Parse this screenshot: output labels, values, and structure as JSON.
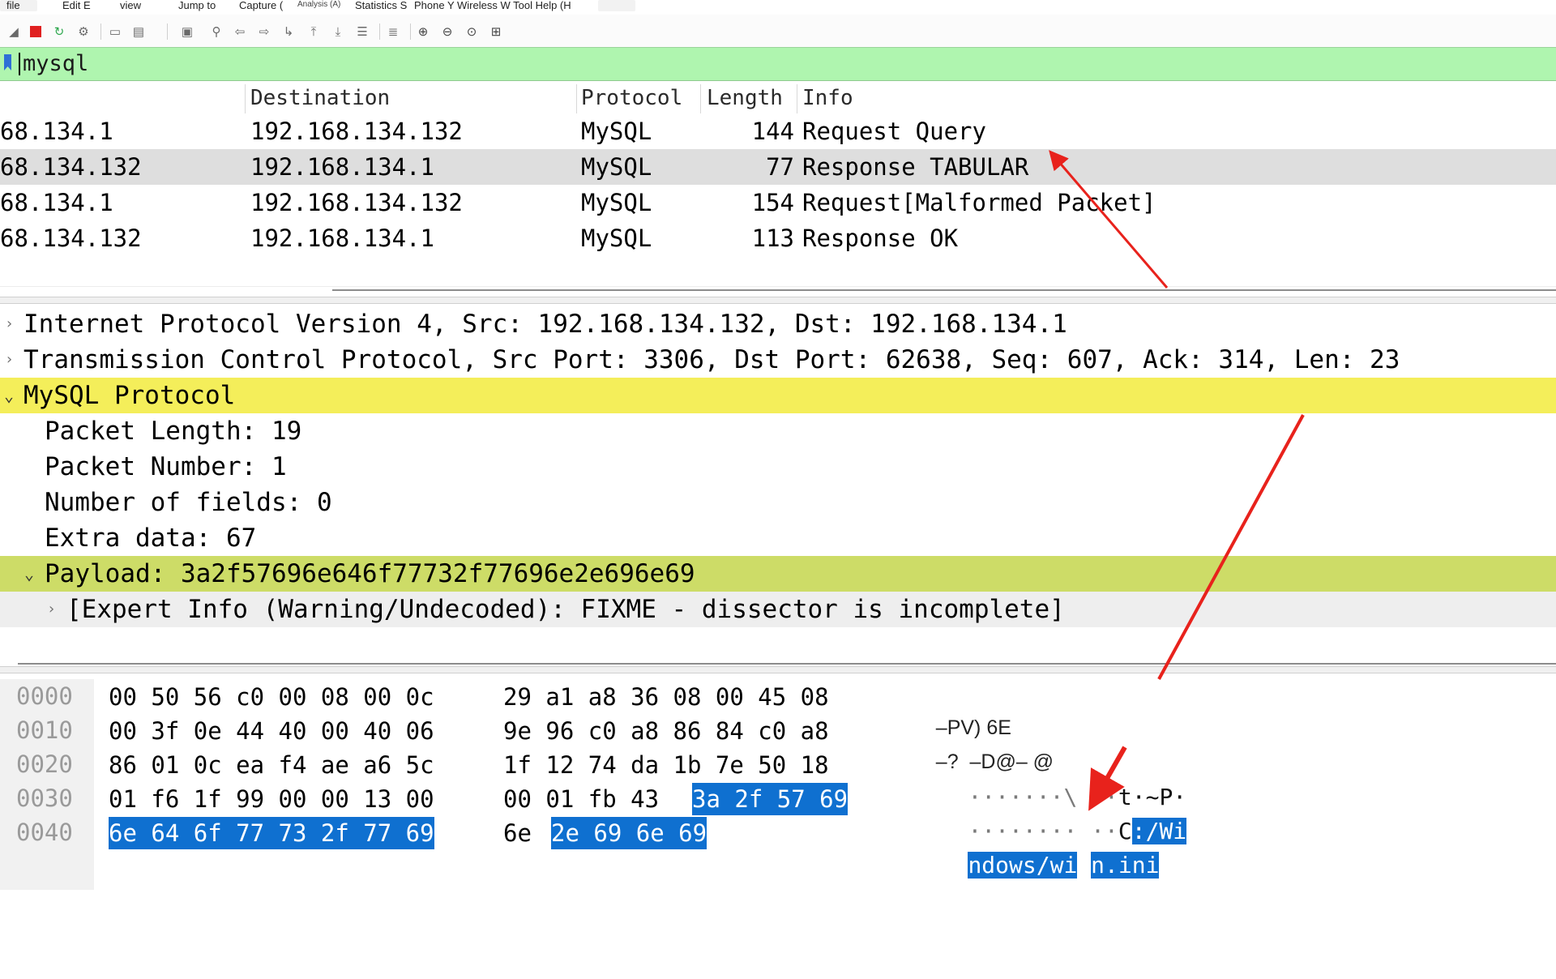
{
  "menu": {
    "file": "file",
    "edit": "Edit E",
    "view": "view",
    "jump": "Jump to",
    "capture": "Capture (",
    "analysis": "Analysis (A)",
    "statistics": "Statistics S",
    "rest": "Phone Y Wireless W Tool Help (H"
  },
  "toolbar": {
    "icons": [
      "shark-fin-icon",
      "stop-icon",
      "restart-icon",
      "options-icon",
      "open-icon",
      "save-icon",
      "close-file-icon",
      "find-icon",
      "back-icon",
      "forward-icon",
      "goto-icon",
      "first-icon",
      "last-icon",
      "autoscroll-icon",
      "colorize-icon",
      "zoom-in-icon",
      "zoom-out-icon",
      "zoom-reset-icon",
      "resize-columns-icon"
    ],
    "stop_color": "#e02020"
  },
  "filter": {
    "value": "mysql",
    "background": "#aff5af"
  },
  "packet_list": {
    "columns": {
      "destination": "Destination",
      "protocol": "Protocol",
      "length": "Length",
      "info": "Info"
    },
    "rows": [
      {
        "source": "68.134.1",
        "destination": "192.168.134.132",
        "protocol": "MySQL",
        "length": "144",
        "info": "Request Query"
      },
      {
        "source": "68.134.132",
        "destination": "192.168.134.1",
        "protocol": "MySQL",
        "length": "77",
        "info": "Response TABULAR"
      },
      {
        "source": "68.134.1",
        "destination": "192.168.134.132",
        "protocol": "MySQL",
        "length": "154",
        "info": "Request[Malformed Packet]"
      },
      {
        "source": "68.134.132",
        "destination": "192.168.134.1",
        "protocol": "MySQL",
        "length": "113",
        "info": "Response OK"
      }
    ],
    "selected_index": 1
  },
  "details": {
    "rows": [
      "Internet Protocol Version 4, Src: 192.168.134.132, Dst: 192.168.134.1",
      "Transmission Control Protocol, Src Port: 3306, Dst Port: 62638, Seq: 607, Ack: 314, Len: 23",
      "MySQL Protocol",
      "Packet Length: 19",
      "Packet Number: 1",
      "Number of fields: 0",
      "Extra data: 67",
      "Payload: 3a2f57696e646f77732f77696e2e696e69",
      "[Expert Info (Warning/Undecoded): FIXME - dissector is incomplete]"
    ],
    "highlight_colors": {
      "protocol": "#f4ee5a",
      "payload": "#cddc67"
    }
  },
  "bytes": {
    "offsets": [
      "0000",
      "0010",
      "0020",
      "0030",
      "0040"
    ],
    "hex": [
      [
        "00 50 56 c0 00 08 00 0c",
        "29 a1 a8 36 08 00 45 08"
      ],
      [
        "00 3f 0e 44 40 00 40 06",
        "9e 96 c0 a8 86 84 c0 a8"
      ],
      [
        "86 01 0c ea f4 ae a6 5c",
        "1f 12 74 da 1b 7e 50 18"
      ],
      [
        "01 f6 1f 99 00 00 13 00",
        "00 01 fb 43",
        "3a 2f 57 69"
      ],
      [
        "6e 64 6f 77 73 2f 77 69",
        "6e",
        "2e 69 6e 69"
      ]
    ],
    "ascii": {
      "l0": "–PV) 6E",
      "l1": "–?  –D@– @",
      "l2_dots": "·······\\ ··",
      "l2_t": "t",
      "l2_rest": "·~P·",
      "l3_dots": "········ ··",
      "l3_c": "C",
      "l3_sel": ":/Wi",
      "l4_a": "ndows/wi",
      "l4_b": "n",
      "l4_c": ".ini"
    },
    "selection_color": "#0f70d0"
  },
  "annotation": {
    "arrow_color": "#e8221c"
  }
}
